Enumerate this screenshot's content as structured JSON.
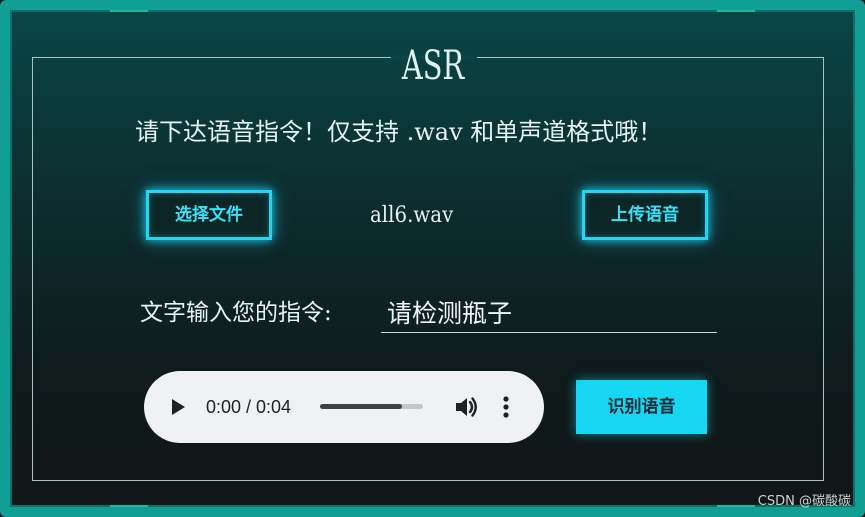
{
  "panel": {
    "title": "ASR",
    "instruction": "请下达语音指令！仅支持 .wav 和单声道格式哦！"
  },
  "file_row": {
    "choose_file_label": "选择文件",
    "selected_filename": "all6.wav",
    "upload_label": "上传语音"
  },
  "text_command": {
    "label": "文字输入您的指令:",
    "value": "请检测瓶子"
  },
  "audio_player": {
    "time_text": "0:00 / 0:04",
    "progress_fraction": 0.8,
    "icons": {
      "play": "play-icon",
      "volume": "volume-icon",
      "more": "more-options-icon"
    }
  },
  "recognize_label": "识别语音",
  "watermark": "CSDN @碳酸碳",
  "colors": {
    "accent": "#1fd8f4",
    "frame": "#109e95",
    "recognize_button_bg": "#17d6f1",
    "player_bg": "#f0f1f3"
  }
}
